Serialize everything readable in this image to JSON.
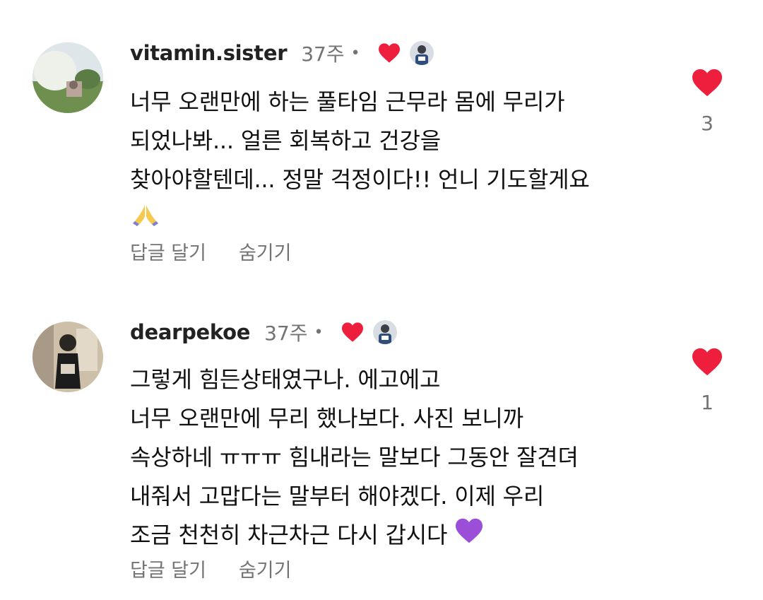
{
  "comments": [
    {
      "username": "vitamin.sister",
      "time": "37주",
      "dot": "•",
      "text_lines": [
        "너무 오랜만에 하는 풀타임 근무라 몸에 무리가",
        "되었나봐... 얼른 회복하고 건강을",
        "찾아야할텐데... 정말 걱정이다!! 언니 기도할게요"
      ],
      "emoji_icon": "praying-hands-icon",
      "reply_label": "답글 달기",
      "hide_label": "숨기기",
      "like_count": "3"
    },
    {
      "username": "dearpekoe",
      "time": "37주",
      "dot": "•",
      "text_lines": [
        "그렇게 힘든상태였구나. 에고에고",
        "너무 오랜만에 무리 했나보다. 사진 보니까",
        "속상하네 ㅠㅠㅠ 힘내라는 말보다 그동안 잘견뎌",
        "내줘서 고맙다는 말부터 해야겠다. 이제 우리",
        "조금 천천히 차근차근 다시 갑시다"
      ],
      "emoji_icon": "purple-heart-icon",
      "reply_label": "답글 달기",
      "hide_label": "숨기기",
      "like_count": "1"
    }
  ],
  "colors": {
    "heart": "#ed1f3c",
    "secondary_text": "#737373",
    "purple_heart": "#9b4fd9"
  }
}
